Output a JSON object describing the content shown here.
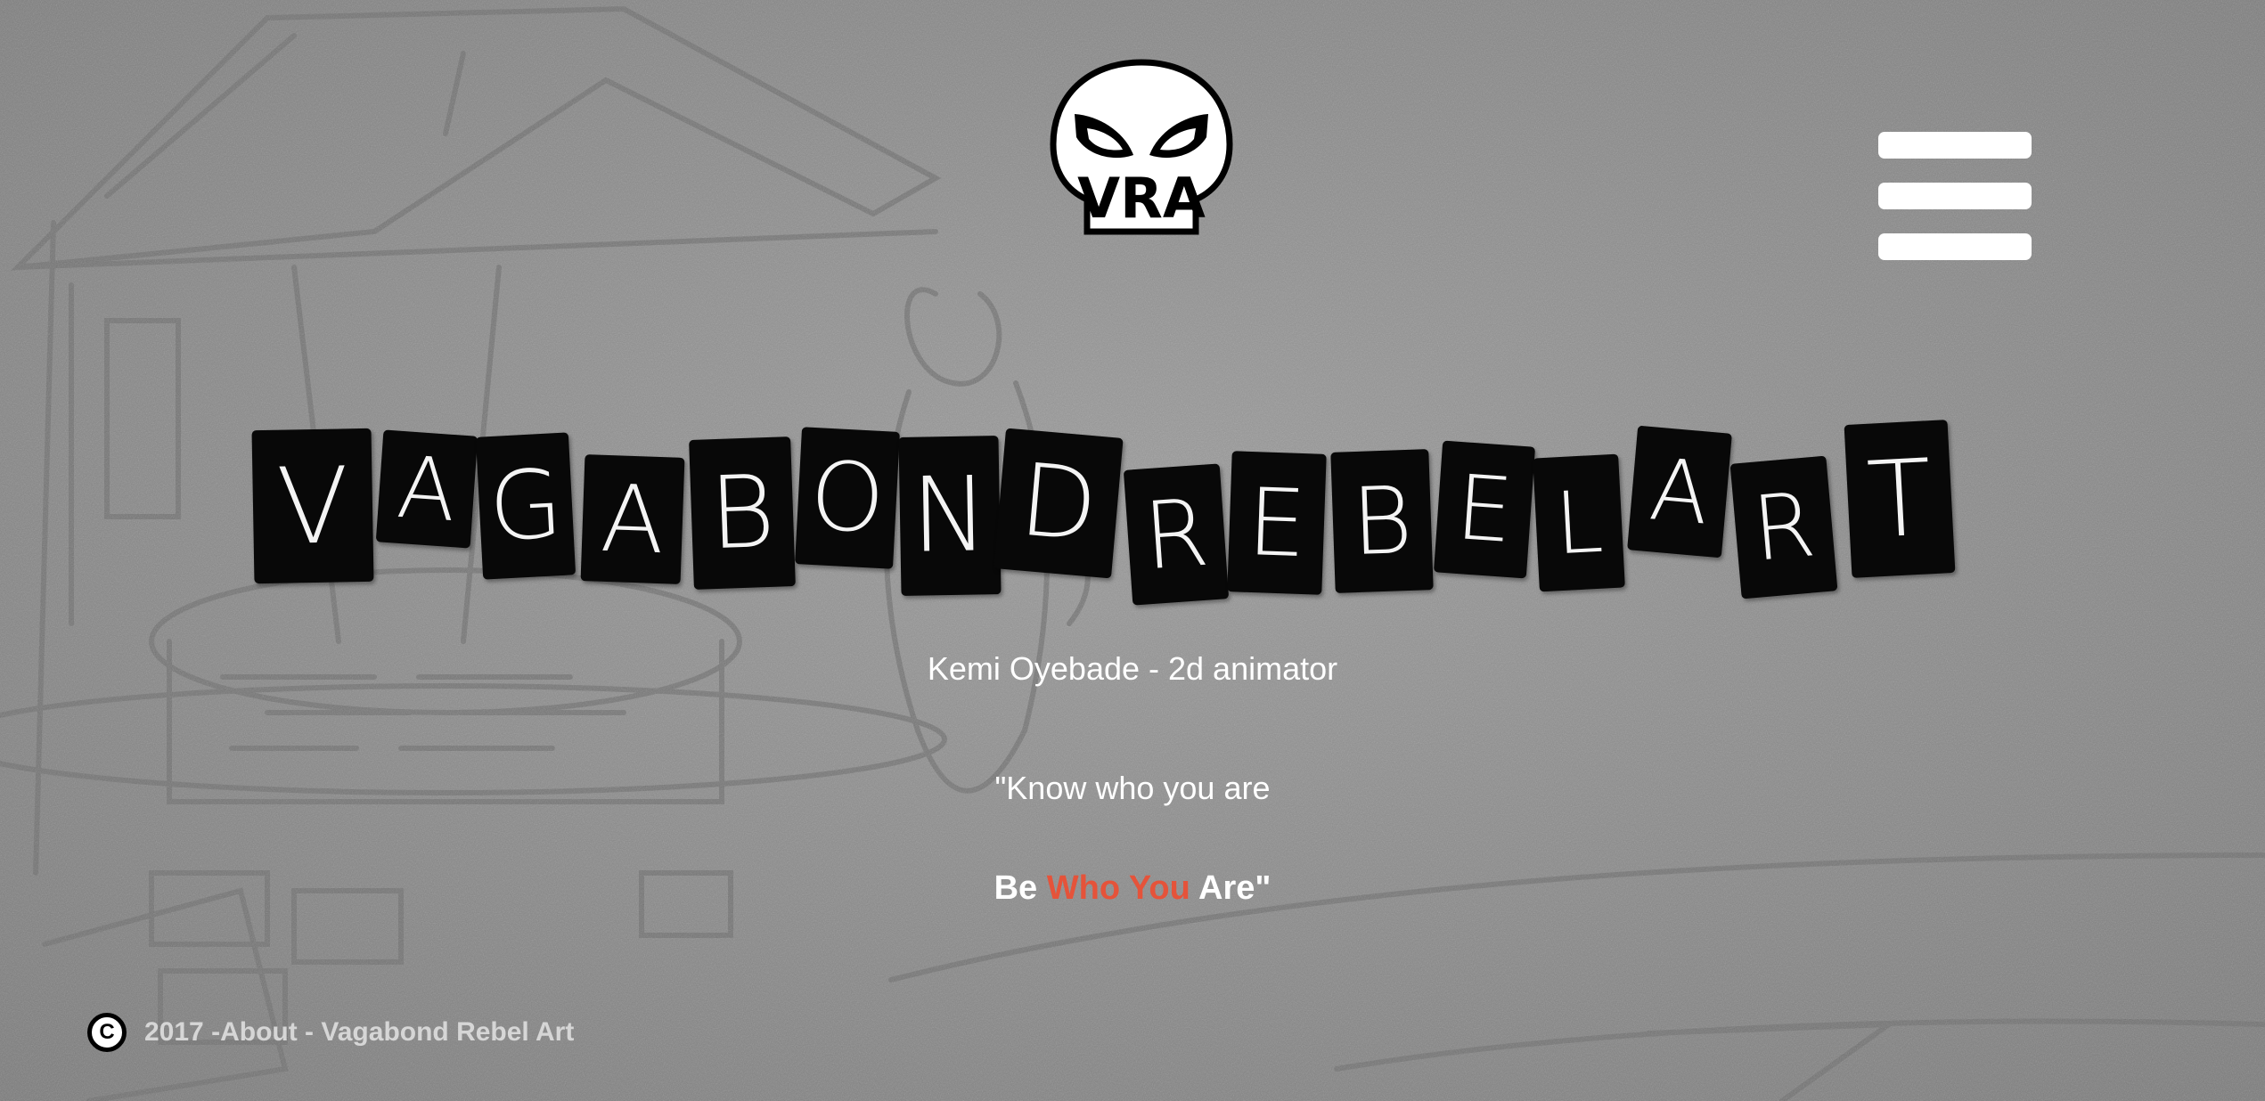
{
  "header": {
    "logo_text": "VRA",
    "menu_icon": "hamburger-menu-icon"
  },
  "hero": {
    "title_letters": [
      "V",
      "A",
      "G",
      "A",
      "B",
      "O",
      "N",
      "D",
      "R",
      "E",
      "B",
      "E",
      "L",
      "A",
      "R",
      "T"
    ],
    "subtitle": "Kemi Oyebade - 2d animator",
    "quote_line1": "\"Know who you are",
    "quote_line2": {
      "part1": "Be ",
      "highlight": "Who You",
      "part3": " Are\""
    }
  },
  "footer": {
    "copyright_icon": "copyright-icon",
    "year_text": "2017 - ",
    "about_label": "About",
    "separator": " - ",
    "brand_label": "Vagabond Rebel Art"
  },
  "colors": {
    "accent": "#e5533a",
    "background": "#8a8a8a",
    "tile": "#080808",
    "text": "#ffffff"
  }
}
